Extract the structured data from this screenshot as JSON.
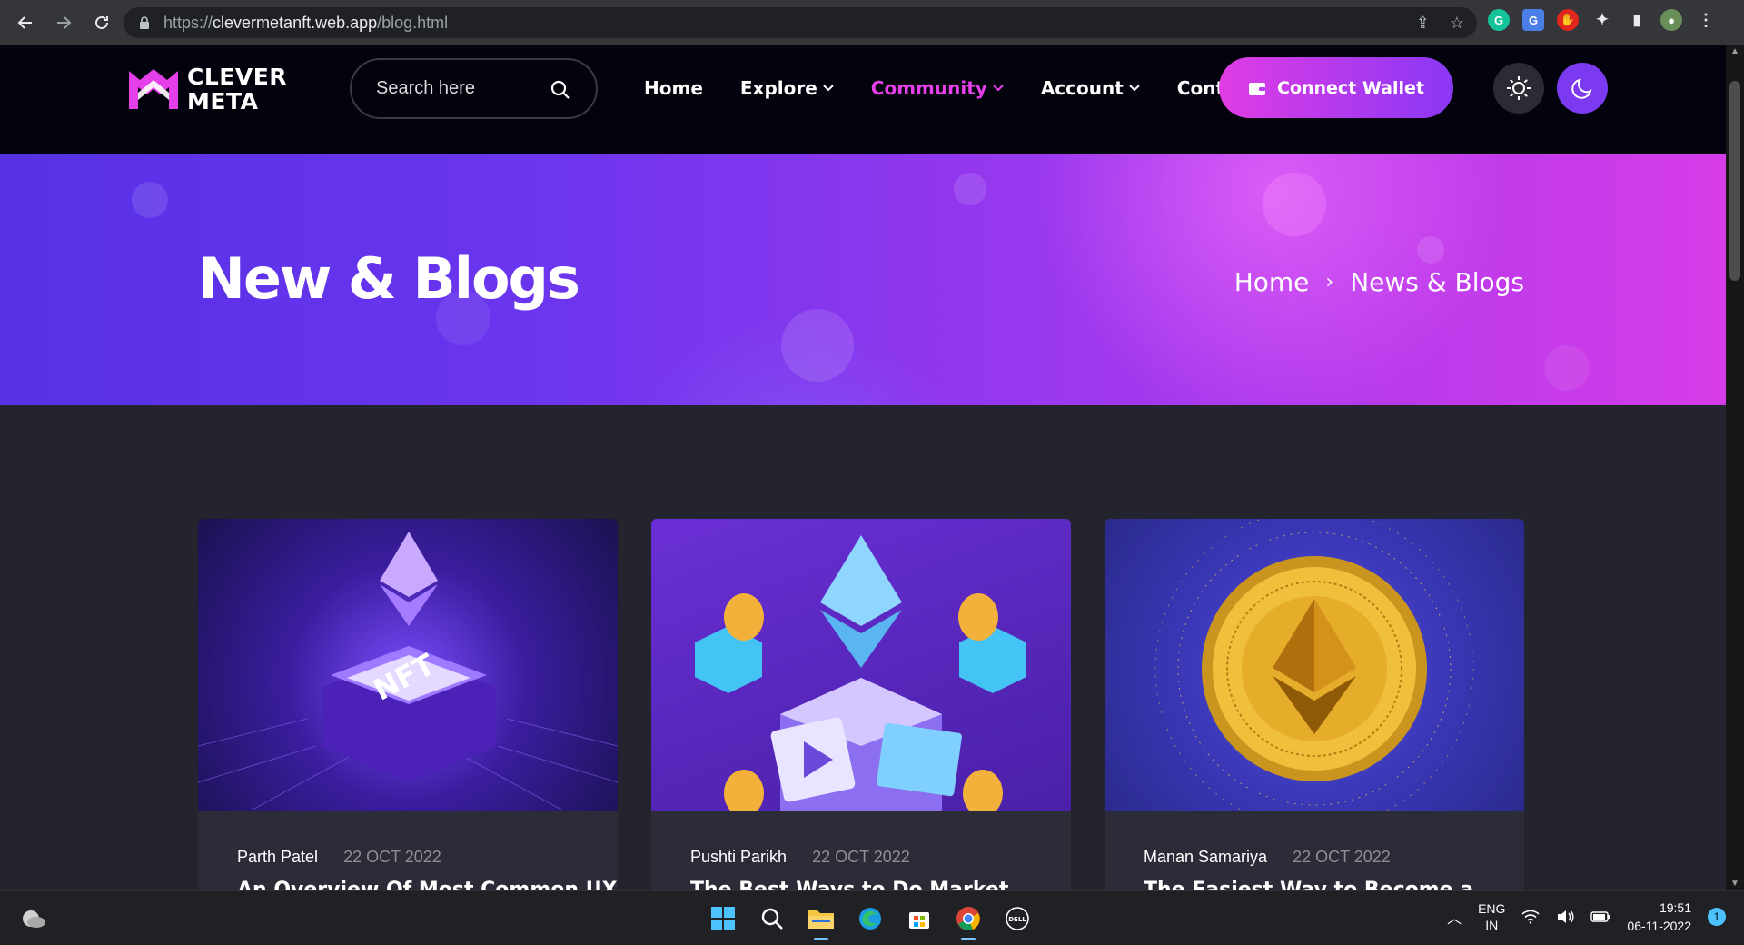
{
  "browser": {
    "url_scheme": "https://",
    "url_host": "clevermetanft.web.app",
    "url_path": "/blog.html"
  },
  "site": {
    "logo_line1": "CLEVER",
    "logo_line2": "META",
    "search_placeholder": "Search here",
    "nav": [
      {
        "label": "Home",
        "has_dropdown": false,
        "active": false
      },
      {
        "label": "Explore",
        "has_dropdown": true,
        "active": false
      },
      {
        "label": "Community",
        "has_dropdown": true,
        "active": true
      },
      {
        "label": "Account",
        "has_dropdown": true,
        "active": false
      },
      {
        "label": "Contact",
        "has_dropdown": false,
        "active": false
      }
    ],
    "connect_wallet": "Connect Wallet",
    "accent_color": "#e53fe9",
    "accent_color_2": "#8a38f5"
  },
  "hero": {
    "title": "New & Blogs",
    "breadcrumb_home": "Home",
    "breadcrumb_sep": "›",
    "breadcrumb_current": "News & Blogs"
  },
  "posts": [
    {
      "author": "Parth Patel",
      "date": "22 OCT 2022",
      "title": "An Overview Of Most Common UX",
      "image": "nft-ethereum-hexagon-icon"
    },
    {
      "author": "Pushti Parikh",
      "date": "22 OCT 2022",
      "title": "The Best Ways to Do Market",
      "image": "ethereum-crystal-coins-icon"
    },
    {
      "author": "Manan Samariya",
      "date": "22 OCT 2022",
      "title": "The Easiest Way to Become a",
      "image": "gold-ethereum-coin-icon"
    }
  ],
  "taskbar": {
    "lang_line1": "ENG",
    "lang_line2": "IN",
    "time": "19:51",
    "date": "06-11-2022",
    "notification_count": "1"
  }
}
